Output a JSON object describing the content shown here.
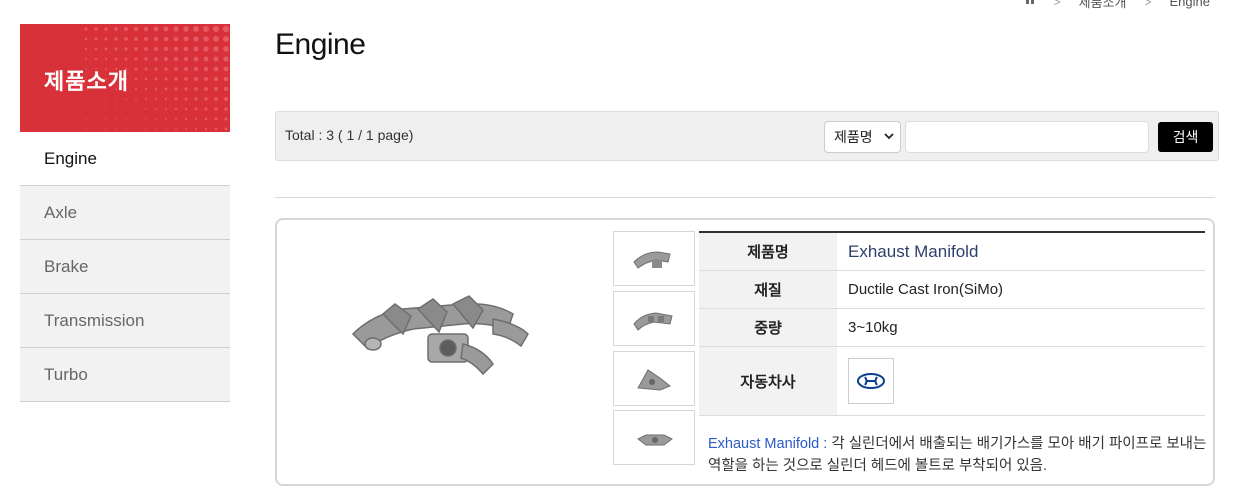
{
  "breadcrumb": {
    "home_icon": "home-icon",
    "items": [
      "제품소개",
      "Engine"
    ]
  },
  "sidebar": {
    "title": "제품소개",
    "items": [
      {
        "label": "Engine",
        "active": true
      },
      {
        "label": "Axle",
        "active": false
      },
      {
        "label": "Brake",
        "active": false
      },
      {
        "label": "Transmission",
        "active": false
      },
      {
        "label": "Turbo",
        "active": false
      }
    ]
  },
  "page": {
    "title": "Engine"
  },
  "search": {
    "total_text": "Total : 3 ( 1 / 1 page)",
    "select_value": "제품명",
    "input_value": "",
    "button_label": "검색"
  },
  "product": {
    "specs": [
      {
        "label": "제품명",
        "value": "Exhaust Manifold"
      },
      {
        "label": "재질",
        "value": "Ductile Cast Iron(SiMo)"
      },
      {
        "label": "중량",
        "value": "3~10kg"
      },
      {
        "label": "자동차사",
        "value": ""
      }
    ],
    "brand_logo": "hyundai-logo",
    "description_keyword": "Exhaust Manifold :",
    "description_text": " 각 실린더에서 배출되는 배기가스를 모아 배기 파이프로 보내는 역할을 하는 것으로 실린더 헤드에 볼트로 부착되어 있음."
  },
  "colors": {
    "accent": "#d9313a",
    "link": "#2a5bc9",
    "name": "#2d3f6b"
  }
}
